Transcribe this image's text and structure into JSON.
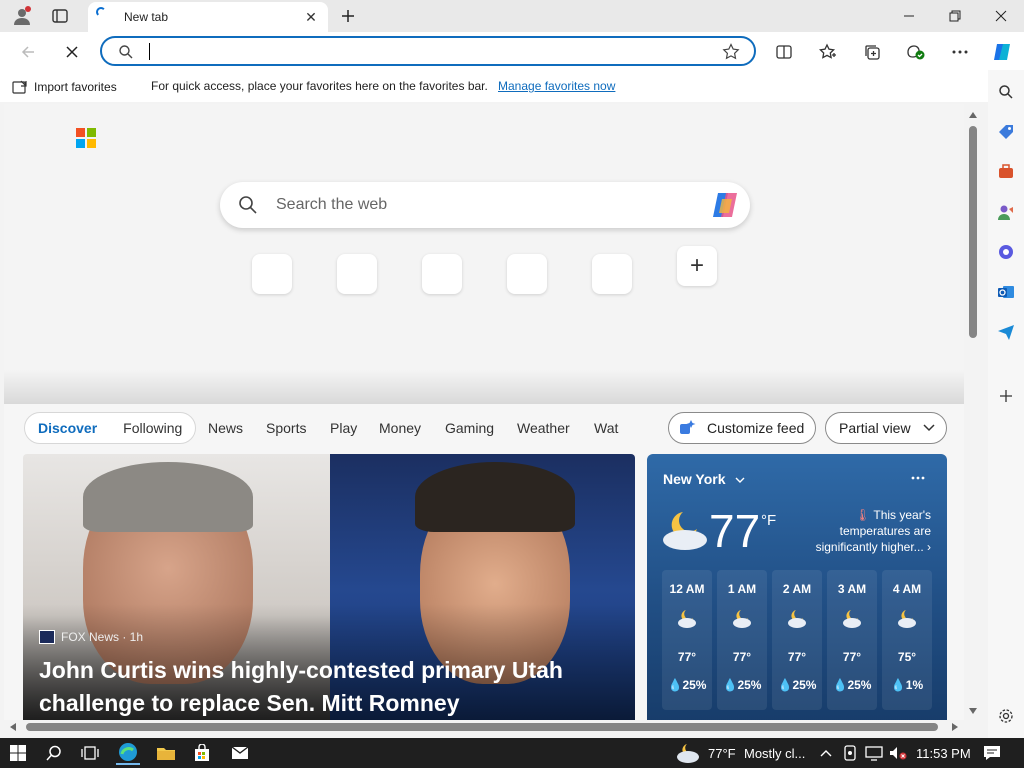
{
  "browser": {
    "tab_title": "New tab",
    "address_value": "",
    "favorites_bar": {
      "import_label": "Import favorites",
      "message": "For quick access, place your favorites here on the favorites bar.",
      "manage_link": "Manage favorites now"
    }
  },
  "newtab": {
    "search_placeholder": "Search the web",
    "add_shortcut": "+"
  },
  "feed": {
    "tabs": [
      "Discover",
      "Following"
    ],
    "nav": [
      "News",
      "Sports",
      "Play",
      "Money",
      "Gaming",
      "Weather",
      "Wat"
    ],
    "customize_label": "Customize feed",
    "view_label": "Partial view",
    "hero": {
      "source": "FOX News · 1h",
      "headline": "John Curtis wins highly-contested primary Utah challenge to replace Sen. Mitt Romney"
    },
    "weather": {
      "city": "New York",
      "temp": "77",
      "unit": "°F",
      "note": "This year's temperatures are significantly higher...",
      "hours": [
        {
          "time": "12 AM",
          "temp": "77°",
          "precip": "💧25%"
        },
        {
          "time": "1 AM",
          "temp": "77°",
          "precip": "💧25%"
        },
        {
          "time": "2 AM",
          "temp": "77°",
          "precip": "💧25%"
        },
        {
          "time": "3 AM",
          "temp": "77°",
          "precip": "💧25%"
        },
        {
          "time": "4 AM",
          "temp": "75°",
          "precip": "💧1%"
        }
      ]
    }
  },
  "taskbar": {
    "weather": "77°F",
    "condition": "Mostly cl...",
    "time": "11:53 PM"
  },
  "colors": {
    "accent": "#0f6cbd",
    "taskbar": "#1f1f1f",
    "weather_card": "#2f6aa8"
  }
}
